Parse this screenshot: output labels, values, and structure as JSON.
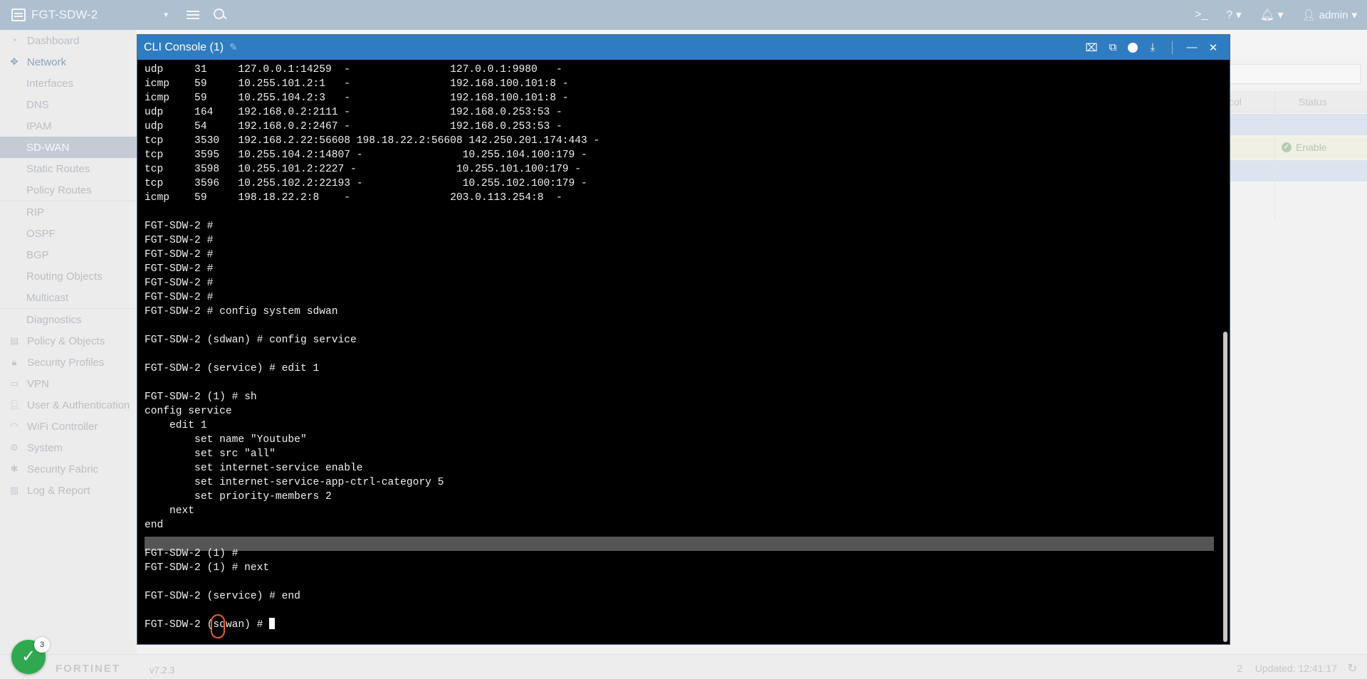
{
  "topbar": {
    "device_name": "FGT-SDW-2",
    "user": "admin"
  },
  "sidebar": {
    "items": [
      {
        "label": "Dashboard",
        "icon": "dashboard-icon",
        "type": "top"
      },
      {
        "label": "Network",
        "icon": "network-icon",
        "type": "top"
      },
      {
        "label": "Interfaces",
        "type": "sub"
      },
      {
        "label": "DNS",
        "type": "sub"
      },
      {
        "label": "IPAM",
        "type": "sub"
      },
      {
        "label": "SD-WAN",
        "type": "sub"
      },
      {
        "label": "Static Routes",
        "type": "sub"
      },
      {
        "label": "Policy Routes",
        "type": "sub"
      },
      {
        "label": "RIP",
        "type": "sub"
      },
      {
        "label": "OSPF",
        "type": "sub"
      },
      {
        "label": "BGP",
        "type": "sub"
      },
      {
        "label": "Routing Objects",
        "type": "sub"
      },
      {
        "label": "Multicast",
        "type": "sub"
      },
      {
        "label": "Diagnostics",
        "type": "sub"
      },
      {
        "label": "Policy & Objects",
        "icon": "policy-icon",
        "type": "top"
      },
      {
        "label": "Security Profiles",
        "icon": "lock-icon",
        "type": "top"
      },
      {
        "label": "VPN",
        "icon": "laptop-icon",
        "type": "top"
      },
      {
        "label": "User & Authentication",
        "icon": "user-icon",
        "type": "top"
      },
      {
        "label": "WiFi Controller",
        "icon": "wifi-icon",
        "type": "top"
      },
      {
        "label": "System",
        "icon": "gear-icon",
        "type": "top"
      },
      {
        "label": "Security Fabric",
        "icon": "fabric-icon",
        "type": "top"
      },
      {
        "label": "Log & Report",
        "icon": "chart-icon",
        "type": "top"
      }
    ]
  },
  "background_table": {
    "col_protocol": "col",
    "col_status": "Status",
    "status_value": "Enable"
  },
  "footer": {
    "brand": "FORTINET",
    "version": "v7.2.3",
    "count": "2",
    "updated": "Updated: 12:41:17",
    "notification_count": "3"
  },
  "console": {
    "title": "CLI Console (1)",
    "lines": [
      "udp     31     127.0.0.1:14259  -                127.0.0.1:9980   -",
      "icmp    59     10.255.101.2:1   -                192.168.100.101:8 -",
      "icmp    59     10.255.104.2:3   -                192.168.100.101:8 -",
      "udp     164    192.168.0.2:2111 -                192.168.0.253:53 -",
      "udp     54     192.168.0.2:2467 -                192.168.0.253:53 -",
      "tcp     3530   192.168.2.22:56608 198.18.22.2:56608 142.250.201.174:443 -",
      "tcp     3595   10.255.104.2:14807 -                10.255.104.100:179 -",
      "tcp     3598   10.255.101.2:2227 -                10.255.101.100:179 -",
      "tcp     3596   10.255.102.2:22193 -                10.255.102.100:179 -",
      "icmp    59     198.18.22.2:8    -                203.0.113.254:8  -",
      "",
      "FGT-SDW-2 #",
      "FGT-SDW-2 #",
      "FGT-SDW-2 #",
      "FGT-SDW-2 #",
      "FGT-SDW-2 #",
      "FGT-SDW-2 #",
      "FGT-SDW-2 # config system sdwan",
      "",
      "FGT-SDW-2 (sdwan) # config service",
      "",
      "FGT-SDW-2 (service) # edit 1",
      "",
      "FGT-SDW-2 (1) # sh",
      "config service",
      "    edit 1",
      "        set name \"Youtube\"",
      "        set src \"all\"",
      "        set internet-service enable",
      "        set internet-service-app-ctrl-category 5",
      "        set priority-members 2",
      "    next",
      "end",
      "",
      "FGT-SDW-2 (1) #",
      "FGT-SDW-2 (1) # next",
      "",
      "FGT-SDW-2 (service) # end",
      ""
    ],
    "prompt": "FGT-SDW-2 (sdwan) # "
  }
}
